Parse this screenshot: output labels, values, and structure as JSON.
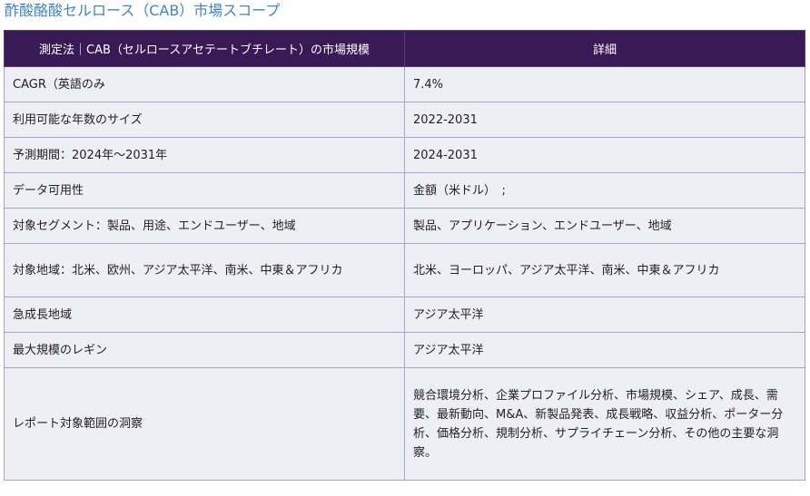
{
  "title": "酢酸酪酸セルロース（CAB）市場スコープ",
  "table": {
    "headers": [
      "測定法｜CAB（セルロースアセテートブチレート）の市場規模",
      "詳細"
    ],
    "rows": [
      {
        "label": "CAGR（英語のみ",
        "value": "7.4%"
      },
      {
        "label": "利用可能な年数のサイズ",
        "value": "2022-2031"
      },
      {
        "label": "予測期間：2024年～2031年",
        "value": "2024-2031"
      },
      {
        "label": "データ可用性",
        "value": "金額（米ドル）　;"
      },
      {
        "label": "対象セグメント：製品、用途、エンドユーザー、地域",
        "value": "製品、アプリケーション、エンドユーザー、地域"
      },
      {
        "label": "対象地域：北米、欧州、アジア太平洋、南米、中東＆アフリカ",
        "value": "北米、ヨーロッパ、アジア太平洋、南米、中東＆アフリカ"
      },
      {
        "label": "急成長地域",
        "value": "アジア太平洋"
      },
      {
        "label": "最大規模のレギン",
        "value": "アジア太平洋"
      },
      {
        "label": "レポート対象範囲の洞察",
        "value": "競合環境分析、企業プロファイル分析、市場規模、シェア、成長、需要、最新動向、M&A、新製品発表、成長戦略、収益分析、ポーター分析、価格分析、規制分析、サプライチェーン分析、その他の主要な洞察。"
      }
    ]
  }
}
